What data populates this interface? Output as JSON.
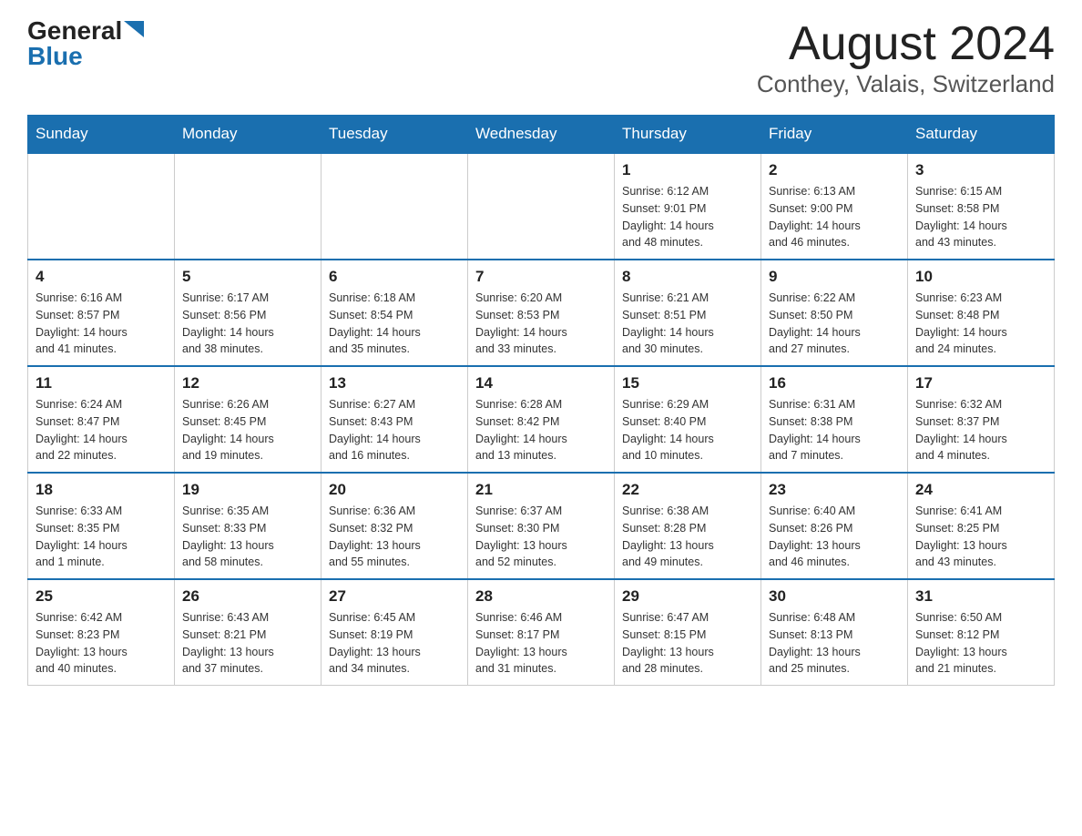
{
  "header": {
    "logo_general": "General",
    "logo_blue": "Blue",
    "month": "August 2024",
    "location": "Conthey, Valais, Switzerland"
  },
  "weekdays": [
    "Sunday",
    "Monday",
    "Tuesday",
    "Wednesday",
    "Thursday",
    "Friday",
    "Saturday"
  ],
  "weeks": [
    [
      {
        "day": "",
        "info": ""
      },
      {
        "day": "",
        "info": ""
      },
      {
        "day": "",
        "info": ""
      },
      {
        "day": "",
        "info": ""
      },
      {
        "day": "1",
        "info": "Sunrise: 6:12 AM\nSunset: 9:01 PM\nDaylight: 14 hours\nand 48 minutes."
      },
      {
        "day": "2",
        "info": "Sunrise: 6:13 AM\nSunset: 9:00 PM\nDaylight: 14 hours\nand 46 minutes."
      },
      {
        "day": "3",
        "info": "Sunrise: 6:15 AM\nSunset: 8:58 PM\nDaylight: 14 hours\nand 43 minutes."
      }
    ],
    [
      {
        "day": "4",
        "info": "Sunrise: 6:16 AM\nSunset: 8:57 PM\nDaylight: 14 hours\nand 41 minutes."
      },
      {
        "day": "5",
        "info": "Sunrise: 6:17 AM\nSunset: 8:56 PM\nDaylight: 14 hours\nand 38 minutes."
      },
      {
        "day": "6",
        "info": "Sunrise: 6:18 AM\nSunset: 8:54 PM\nDaylight: 14 hours\nand 35 minutes."
      },
      {
        "day": "7",
        "info": "Sunrise: 6:20 AM\nSunset: 8:53 PM\nDaylight: 14 hours\nand 33 minutes."
      },
      {
        "day": "8",
        "info": "Sunrise: 6:21 AM\nSunset: 8:51 PM\nDaylight: 14 hours\nand 30 minutes."
      },
      {
        "day": "9",
        "info": "Sunrise: 6:22 AM\nSunset: 8:50 PM\nDaylight: 14 hours\nand 27 minutes."
      },
      {
        "day": "10",
        "info": "Sunrise: 6:23 AM\nSunset: 8:48 PM\nDaylight: 14 hours\nand 24 minutes."
      }
    ],
    [
      {
        "day": "11",
        "info": "Sunrise: 6:24 AM\nSunset: 8:47 PM\nDaylight: 14 hours\nand 22 minutes."
      },
      {
        "day": "12",
        "info": "Sunrise: 6:26 AM\nSunset: 8:45 PM\nDaylight: 14 hours\nand 19 minutes."
      },
      {
        "day": "13",
        "info": "Sunrise: 6:27 AM\nSunset: 8:43 PM\nDaylight: 14 hours\nand 16 minutes."
      },
      {
        "day": "14",
        "info": "Sunrise: 6:28 AM\nSunset: 8:42 PM\nDaylight: 14 hours\nand 13 minutes."
      },
      {
        "day": "15",
        "info": "Sunrise: 6:29 AM\nSunset: 8:40 PM\nDaylight: 14 hours\nand 10 minutes."
      },
      {
        "day": "16",
        "info": "Sunrise: 6:31 AM\nSunset: 8:38 PM\nDaylight: 14 hours\nand 7 minutes."
      },
      {
        "day": "17",
        "info": "Sunrise: 6:32 AM\nSunset: 8:37 PM\nDaylight: 14 hours\nand 4 minutes."
      }
    ],
    [
      {
        "day": "18",
        "info": "Sunrise: 6:33 AM\nSunset: 8:35 PM\nDaylight: 14 hours\nand 1 minute."
      },
      {
        "day": "19",
        "info": "Sunrise: 6:35 AM\nSunset: 8:33 PM\nDaylight: 13 hours\nand 58 minutes."
      },
      {
        "day": "20",
        "info": "Sunrise: 6:36 AM\nSunset: 8:32 PM\nDaylight: 13 hours\nand 55 minutes."
      },
      {
        "day": "21",
        "info": "Sunrise: 6:37 AM\nSunset: 8:30 PM\nDaylight: 13 hours\nand 52 minutes."
      },
      {
        "day": "22",
        "info": "Sunrise: 6:38 AM\nSunset: 8:28 PM\nDaylight: 13 hours\nand 49 minutes."
      },
      {
        "day": "23",
        "info": "Sunrise: 6:40 AM\nSunset: 8:26 PM\nDaylight: 13 hours\nand 46 minutes."
      },
      {
        "day": "24",
        "info": "Sunrise: 6:41 AM\nSunset: 8:25 PM\nDaylight: 13 hours\nand 43 minutes."
      }
    ],
    [
      {
        "day": "25",
        "info": "Sunrise: 6:42 AM\nSunset: 8:23 PM\nDaylight: 13 hours\nand 40 minutes."
      },
      {
        "day": "26",
        "info": "Sunrise: 6:43 AM\nSunset: 8:21 PM\nDaylight: 13 hours\nand 37 minutes."
      },
      {
        "day": "27",
        "info": "Sunrise: 6:45 AM\nSunset: 8:19 PM\nDaylight: 13 hours\nand 34 minutes."
      },
      {
        "day": "28",
        "info": "Sunrise: 6:46 AM\nSunset: 8:17 PM\nDaylight: 13 hours\nand 31 minutes."
      },
      {
        "day": "29",
        "info": "Sunrise: 6:47 AM\nSunset: 8:15 PM\nDaylight: 13 hours\nand 28 minutes."
      },
      {
        "day": "30",
        "info": "Sunrise: 6:48 AM\nSunset: 8:13 PM\nDaylight: 13 hours\nand 25 minutes."
      },
      {
        "day": "31",
        "info": "Sunrise: 6:50 AM\nSunset: 8:12 PM\nDaylight: 13 hours\nand 21 minutes."
      }
    ]
  ]
}
